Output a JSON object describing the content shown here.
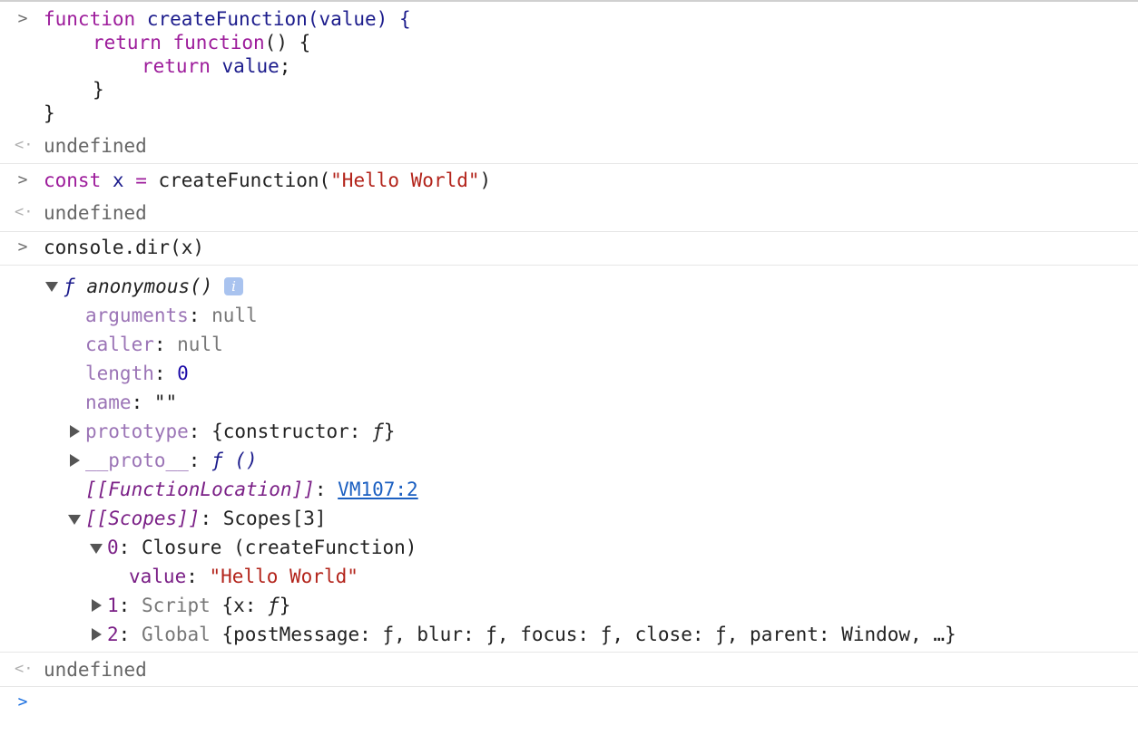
{
  "code_block": {
    "line1": {
      "kw": "function",
      "name": "createFunction",
      "params": "(value) {"
    },
    "line2": {
      "kw1": "return",
      "kw2": "function",
      "rest": "() {"
    },
    "line3": {
      "kw": "return",
      "ident": "value",
      "rest": ";"
    },
    "line4": "}",
    "line5": "}"
  },
  "results": {
    "undefined_1": "undefined",
    "undefined_2": "undefined",
    "undefined_3": "undefined"
  },
  "command2": {
    "kw": "const",
    "ident": "x",
    "eq": "=",
    "call": "createFunction(",
    "arg": "\"Hello World\"",
    "close": ")"
  },
  "command3": "console.dir(x)",
  "tree": {
    "header_f": "ƒ",
    "header_name": "anonymous()",
    "info_glyph": "i",
    "arguments": {
      "key": "arguments",
      "value": "null"
    },
    "caller": {
      "key": "caller",
      "value": "null"
    },
    "length": {
      "key": "length",
      "value": "0"
    },
    "name": {
      "key": "name",
      "value": "\"\""
    },
    "prototype": {
      "key": "prototype",
      "value_open": "{constructor: ",
      "value_f": "ƒ",
      "value_close": "}"
    },
    "proto": {
      "key": "__proto__",
      "value_f": "ƒ",
      "value_paren": "()"
    },
    "function_location": {
      "key": "[[FunctionLocation]]",
      "link": "VM107:2"
    },
    "scopes": {
      "key": "[[Scopes]]",
      "value": "Scopes[3]"
    },
    "scope0": {
      "index": "0",
      "label": "Closure (createFunction)"
    },
    "scope0_value": {
      "key": "value",
      "value": "\"Hello World\""
    },
    "scope1": {
      "index": "1",
      "label": "Script",
      "value_open": "{x: ",
      "value_f": "ƒ",
      "value_close": "}"
    },
    "scope2": {
      "index": "2",
      "label": "Global",
      "value": "{postMessage: ƒ, blur: ƒ, focus: ƒ, close: ƒ, parent: Window, …}"
    }
  },
  "gutter": {
    "input_prompt": ">",
    "return_arrow": "<·",
    "active_prompt": ">"
  },
  "colors": {
    "keyword": "#9d1c9b",
    "string": "#b3241b",
    "number": "#1c0ba8",
    "link": "#1b5fc1",
    "prompt_active": "#1a6fe0"
  }
}
